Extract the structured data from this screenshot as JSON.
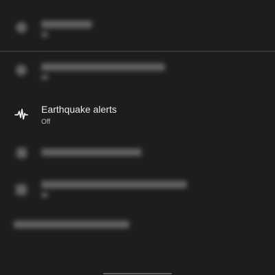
{
  "settings_list": {
    "items": [
      {
        "icon": "blurred-icon",
        "title": "",
        "subtitle": "",
        "blurred": true
      },
      {
        "icon": "blurred-icon",
        "title": "",
        "subtitle": "",
        "blurred": true
      },
      {
        "icon": "earthquake-icon",
        "title": "Earthquake alerts",
        "subtitle": "Off",
        "blurred": false
      },
      {
        "icon": "blurred-icon",
        "title": "",
        "subtitle": "",
        "blurred": true
      },
      {
        "icon": "blurred-icon",
        "title": "",
        "subtitle": "",
        "blurred": true
      }
    ],
    "footer_link": ""
  },
  "colors": {
    "background": "#1d1d1f",
    "divider": "#4a4a4c",
    "text_primary": "#ececec",
    "text_secondary": "#bdbdbd"
  }
}
